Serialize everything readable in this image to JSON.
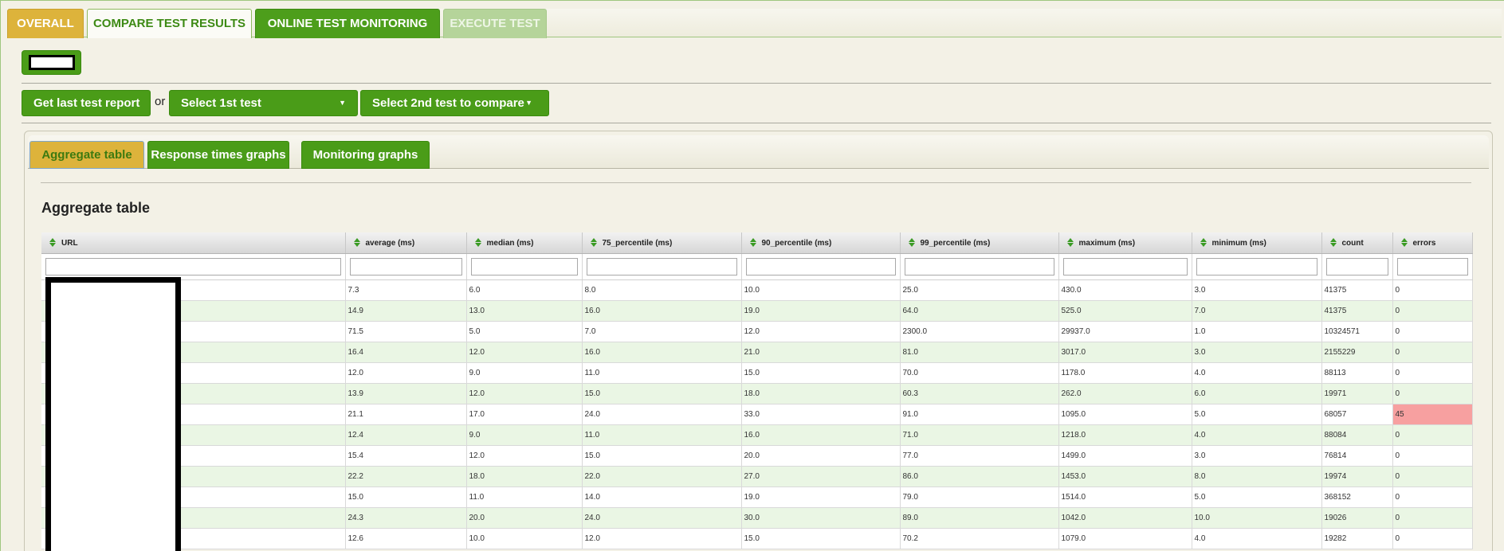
{
  "top_tabs": [
    {
      "label": "OVERALL"
    },
    {
      "label": "COMPARE TEST RESULTS"
    },
    {
      "label": "ONLINE TEST MONITORING"
    },
    {
      "label": "EXECUTE TEST"
    }
  ],
  "controls": {
    "last_report_label": "Get last test report",
    "or_label": "or",
    "select_first_label": "Select 1st test",
    "select_second_label": "Select 2nd test to compare"
  },
  "sub_tabs": [
    {
      "label": "Aggregate table"
    },
    {
      "label": "Response times graphs"
    },
    {
      "label": "Monitoring graphs"
    }
  ],
  "section_title": "Aggregate table",
  "table": {
    "columns": [
      "URL",
      "average (ms)",
      "median (ms)",
      "75_percentile (ms)",
      "90_percentile (ms)",
      "99_percentile (ms)",
      "maximum (ms)",
      "minimum (ms)",
      "count",
      "errors"
    ],
    "rows": [
      [
        "",
        "7.3",
        "6.0",
        "8.0",
        "10.0",
        "25.0",
        "430.0",
        "3.0",
        "41375",
        "0"
      ],
      [
        "",
        "14.9",
        "13.0",
        "16.0",
        "19.0",
        "64.0",
        "525.0",
        "7.0",
        "41375",
        "0"
      ],
      [
        "",
        "71.5",
        "5.0",
        "7.0",
        "12.0",
        "2300.0",
        "29937.0",
        "1.0",
        "10324571",
        "0"
      ],
      [
        "",
        "16.4",
        "12.0",
        "16.0",
        "21.0",
        "81.0",
        "3017.0",
        "3.0",
        "2155229",
        "0"
      ],
      [
        "",
        "12.0",
        "9.0",
        "11.0",
        "15.0",
        "70.0",
        "1178.0",
        "4.0",
        "88113",
        "0"
      ],
      [
        "",
        "13.9",
        "12.0",
        "15.0",
        "18.0",
        "60.3",
        "262.0",
        "6.0",
        "19971",
        "0"
      ],
      [
        "",
        "21.1",
        "17.0",
        "24.0",
        "33.0",
        "91.0",
        "1095.0",
        "5.0",
        "68057",
        "45"
      ],
      [
        "",
        "12.4",
        "9.0",
        "11.0",
        "16.0",
        "71.0",
        "1218.0",
        "4.0",
        "88084",
        "0"
      ],
      [
        "",
        "15.4",
        "12.0",
        "15.0",
        "20.0",
        "77.0",
        "1499.0",
        "3.0",
        "76814",
        "0"
      ],
      [
        "",
        "22.2",
        "18.0",
        "22.0",
        "27.0",
        "86.0",
        "1453.0",
        "8.0",
        "19974",
        "0"
      ],
      [
        "",
        "15.0",
        "11.0",
        "14.0",
        "19.0",
        "79.0",
        "1514.0",
        "5.0",
        "368152",
        "0"
      ],
      [
        "",
        "24.3",
        "20.0",
        "24.0",
        "30.0",
        "89.0",
        "1042.0",
        "10.0",
        "19026",
        "0"
      ],
      [
        "",
        "12.6",
        "10.0",
        "12.0",
        "15.0",
        "70.2",
        "1079.0",
        "4.0",
        "19282",
        "0"
      ]
    ],
    "error_highlight_color": "#f7a0a0"
  },
  "icons": {
    "sort": "sort-arrows-icon",
    "caret": "chevron-down-icon"
  },
  "colors": {
    "accent_green": "#4a9c18",
    "accent_gold": "#ddb33b",
    "row_alt": "#eaf6e4"
  }
}
